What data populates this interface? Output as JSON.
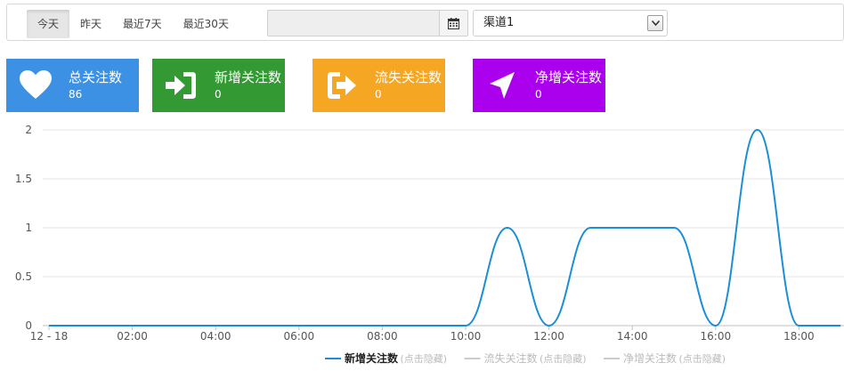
{
  "toolbar": {
    "ranges": [
      {
        "label": "今天",
        "active": true
      },
      {
        "label": "昨天",
        "active": false
      },
      {
        "label": "最近7天",
        "active": false
      },
      {
        "label": "最近30天",
        "active": false
      }
    ],
    "date_value": "",
    "calendar_icon": "calendar-icon",
    "channel": {
      "selected": "渠道1"
    }
  },
  "cards": [
    {
      "label": "总关注数",
      "value": "86",
      "color": "#3d91e4",
      "icon": "heart-icon"
    },
    {
      "label": "新增关注数",
      "value": "0",
      "color": "#339933",
      "icon": "sign-in-icon"
    },
    {
      "label": "流失关注数",
      "value": "0",
      "color": "#f5a623",
      "icon": "sign-out-icon"
    },
    {
      "label": "净增关注数",
      "value": "0",
      "color": "#aa00ee",
      "icon": "location-arrow-icon"
    }
  ],
  "chart_data": {
    "type": "line",
    "title": "",
    "xlabel": "",
    "ylabel": "",
    "x_ticks": [
      "12 - 18",
      "02:00",
      "04:00",
      "06:00",
      "08:00",
      "10:00",
      "12:00",
      "14:00",
      "16:00",
      "18:00"
    ],
    "y_ticks": [
      "0",
      "0.5",
      "1",
      "1.5",
      "2"
    ],
    "ylim": [
      0,
      2
    ],
    "grid": true,
    "legend_position": "bottom",
    "hidden_hint": "(点击隐藏)",
    "x": [
      "00:00",
      "01:00",
      "02:00",
      "03:00",
      "04:00",
      "05:00",
      "06:00",
      "07:00",
      "08:00",
      "09:00",
      "10:00",
      "11:00",
      "12:00",
      "13:00",
      "14:00",
      "15:00",
      "16:00",
      "17:00",
      "18:00",
      "19:00"
    ],
    "series": [
      {
        "name": "新增关注数",
        "color": "#1a8fd8",
        "visible": true,
        "values": [
          0,
          0,
          0,
          0,
          0,
          0,
          0,
          0,
          0,
          0,
          0,
          1,
          0,
          1,
          1,
          1,
          0,
          2,
          0,
          0
        ]
      },
      {
        "name": "流失关注数",
        "color": "#cccccc",
        "visible": false,
        "values": [
          0,
          0,
          0,
          0,
          0,
          0,
          0,
          0,
          0,
          0,
          0,
          0,
          0,
          0,
          0,
          0,
          0,
          0,
          0,
          0
        ]
      },
      {
        "name": "净增关注数",
        "color": "#cccccc",
        "visible": false,
        "values": [
          0,
          0,
          0,
          0,
          0,
          0,
          0,
          0,
          0,
          0,
          0,
          0,
          0,
          0,
          0,
          0,
          0,
          0,
          0,
          0
        ]
      }
    ]
  }
}
